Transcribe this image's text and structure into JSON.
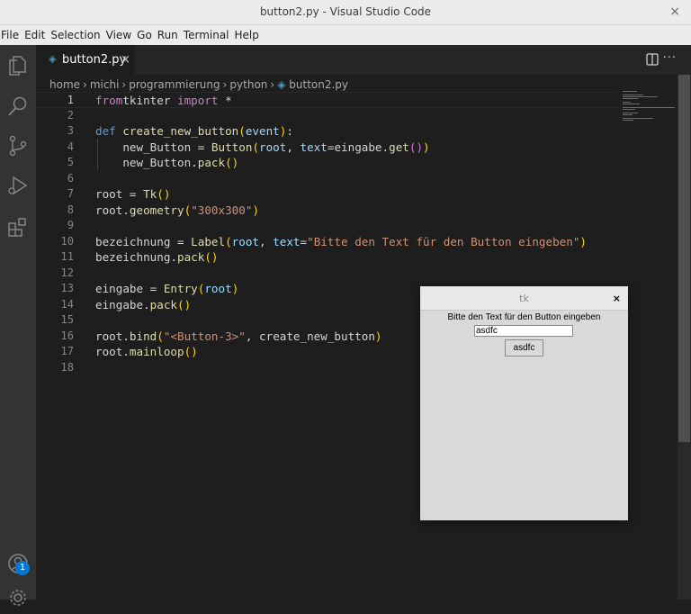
{
  "window": {
    "title": "button2.py - Visual Studio Code",
    "close": "×"
  },
  "menu": [
    "File",
    "Edit",
    "Selection",
    "View",
    "Go",
    "Run",
    "Terminal",
    "Help"
  ],
  "activity_bar": {
    "icons": [
      "explorer-icon",
      "search-icon",
      "source-control-icon",
      "run-debug-icon",
      "extensions-icon",
      "account-icon",
      "settings-gear-icon"
    ],
    "account_badge": "1"
  },
  "tab": {
    "label": "button2.py",
    "close": "×",
    "file_icon": "python-file-icon"
  },
  "editor_actions": {
    "split": "split-editor-icon",
    "more": "···"
  },
  "breadcrumb": [
    "home",
    "michi",
    "programmierung",
    "python",
    "button2.py"
  ],
  "code": {
    "lines": [
      {
        "n": "1",
        "tokens": [
          [
            "kw",
            "from"
          ],
          [
            "",
            "tkinter "
          ],
          [
            "kw",
            "import"
          ],
          [
            "",
            " *"
          ]
        ]
      },
      {
        "n": "2",
        "tokens": []
      },
      {
        "n": "3",
        "tokens": [
          [
            "def",
            "def"
          ],
          [
            "",
            " "
          ],
          [
            "fn",
            "create_new_button"
          ],
          [
            "p1",
            "("
          ],
          [
            "var",
            "event"
          ],
          [
            "p1",
            ")"
          ],
          [
            "",
            ":"
          ]
        ]
      },
      {
        "n": "4",
        "tokens": [
          [
            "",
            "    new_Button = "
          ],
          [
            "fn",
            "Button"
          ],
          [
            "p1",
            "("
          ],
          [
            "var",
            "root"
          ],
          [
            "",
            ", "
          ],
          [
            "var",
            "text"
          ],
          [
            "",
            "=eingabe."
          ],
          [
            "fn",
            "get"
          ],
          [
            "p2",
            "()"
          ],
          [
            "p1",
            ")"
          ]
        ]
      },
      {
        "n": "5",
        "tokens": [
          [
            "",
            "    new_Button."
          ],
          [
            "fn",
            "pack"
          ],
          [
            "p1",
            "()"
          ]
        ]
      },
      {
        "n": "6",
        "tokens": []
      },
      {
        "n": "7",
        "tokens": [
          [
            "",
            "root = "
          ],
          [
            "fn",
            "Tk"
          ],
          [
            "p1",
            "()"
          ]
        ]
      },
      {
        "n": "8",
        "tokens": [
          [
            "",
            "root."
          ],
          [
            "fn",
            "geometry"
          ],
          [
            "p1",
            "("
          ],
          [
            "str",
            "\"300x300\""
          ],
          [
            "p1",
            ")"
          ]
        ]
      },
      {
        "n": "9",
        "tokens": []
      },
      {
        "n": "10",
        "tokens": [
          [
            "",
            "bezeichnung = "
          ],
          [
            "fn",
            "Label"
          ],
          [
            "p1",
            "("
          ],
          [
            "var",
            "root"
          ],
          [
            "",
            ", "
          ],
          [
            "var",
            "text"
          ],
          [
            "",
            "="
          ],
          [
            "str",
            "\"Bitte den Text für den Button eingeben\""
          ],
          [
            "p1",
            ")"
          ]
        ]
      },
      {
        "n": "11",
        "tokens": [
          [
            "",
            "bezeichnung."
          ],
          [
            "fn",
            "pack"
          ],
          [
            "p1",
            "()"
          ]
        ]
      },
      {
        "n": "12",
        "tokens": []
      },
      {
        "n": "13",
        "tokens": [
          [
            "",
            "eingabe = "
          ],
          [
            "fn",
            "Entry"
          ],
          [
            "p1",
            "("
          ],
          [
            "var",
            "root"
          ],
          [
            "p1",
            ")"
          ]
        ]
      },
      {
        "n": "14",
        "tokens": [
          [
            "",
            "eingabe."
          ],
          [
            "fn",
            "pack"
          ],
          [
            "p1",
            "()"
          ]
        ]
      },
      {
        "n": "15",
        "tokens": []
      },
      {
        "n": "16",
        "tokens": [
          [
            "",
            "root."
          ],
          [
            "fn",
            "bind"
          ],
          [
            "p1",
            "("
          ],
          [
            "str",
            "\"<Button-3>\""
          ],
          [
            "",
            ", create_new_button"
          ],
          [
            "p1",
            ")"
          ]
        ]
      },
      {
        "n": "17",
        "tokens": [
          [
            "",
            "root."
          ],
          [
            "fn",
            "mainloop"
          ],
          [
            "p1",
            "()"
          ]
        ]
      },
      {
        "n": "18",
        "tokens": []
      }
    ]
  },
  "tk_window": {
    "title": "tk",
    "close": "×",
    "label": "Bitte den Text für den Button eingeben",
    "entry_value": "asdfc",
    "button_label": "asdfc"
  }
}
